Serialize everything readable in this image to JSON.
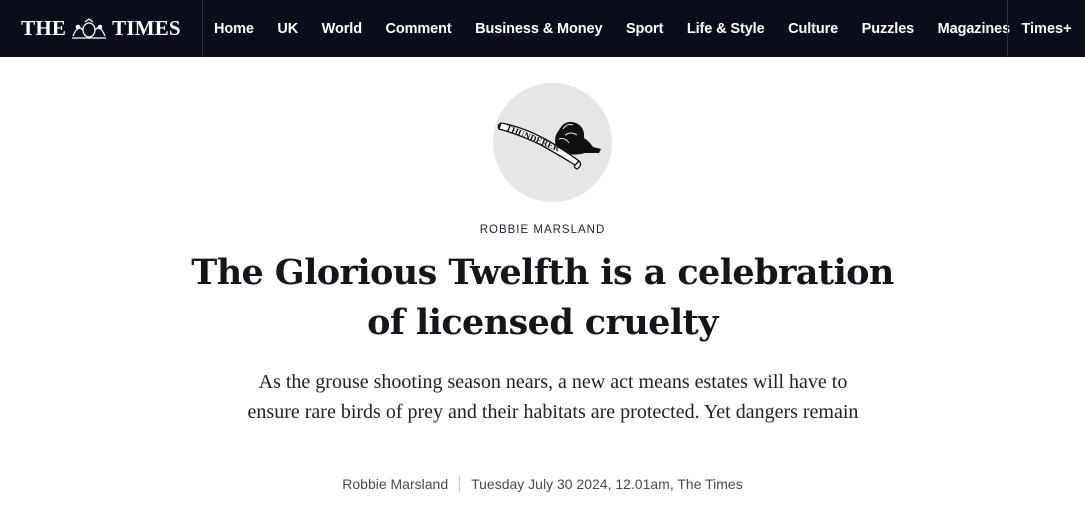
{
  "header": {
    "logo_left": "THE",
    "logo_right": "TIMES",
    "nav": [
      "Home",
      "UK",
      "World",
      "Comment",
      "Business & Money",
      "Sport",
      "Life & Style",
      "Culture",
      "Puzzles",
      "Magazines"
    ],
    "subscribe": "Times+"
  },
  "article": {
    "emblem_text": "THUNDERER",
    "kicker": "ROBBIE MARSLAND",
    "headline": "The Glorious Twelfth is a celebration of licensed cruelty",
    "standfirst": "As the grouse shooting season nears, a new act means estates will have to ensure rare birds of prey and their habitats are protected. Yet dangers remain",
    "byline_author": "Robbie Marsland",
    "byline_date": "Tuesday July 30 2024, 12.01am, The Times"
  },
  "colors": {
    "nav_background": "#0b0e1a",
    "emblem_background": "#e6e6e6"
  }
}
